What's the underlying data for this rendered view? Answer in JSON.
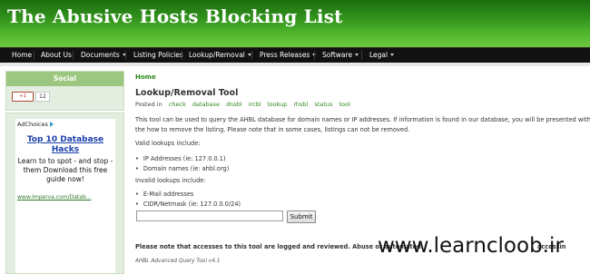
{
  "site": {
    "title": "The Abusive Hosts Blocking List"
  },
  "nav": {
    "items": [
      {
        "label": "Home",
        "dropdown": false
      },
      {
        "label": "About Us",
        "dropdown": false
      },
      {
        "label": "Documents",
        "dropdown": true
      },
      {
        "label": "Listing Policies",
        "dropdown": false
      },
      {
        "label": "Lookup/Removal",
        "dropdown": true
      },
      {
        "label": "Press Releases",
        "dropdown": true
      },
      {
        "label": "Software",
        "dropdown": true
      },
      {
        "label": "Legal",
        "dropdown": true
      }
    ]
  },
  "sidebar": {
    "social": {
      "heading": "Social",
      "plusone_label": "+1",
      "plusone_count": "12"
    },
    "ad": {
      "choices_label": "AdChoices",
      "title": "Top 10 Database Hacks",
      "description": "Learn to to spot - and stop - them Download this free guide now!",
      "url": "www.Imperva.com/Datab..."
    }
  },
  "content": {
    "breadcrumb": "Home",
    "title": "Lookup/Removal Tool",
    "posted_label": "Posted in",
    "tags": [
      "check",
      "database",
      "dnsbl",
      "ircbl",
      "lookup",
      "rhsbl",
      "status",
      "tool"
    ],
    "intro": "This tool can be used to query the AHBL database for domain names or IP addresses. If information is found in our database, you will be presented with the how to remove the listing. Please note that in some cases, listings can not be removed.",
    "valid_label": "Valid lookups include:",
    "valid_items": [
      "IP Addresses (ie: 127.0.0.1)",
      "Domain names (ie: ahbl.org)"
    ],
    "invalid_label": "Invalid lookups include:",
    "invalid_items": [
      "E-Mail addresses",
      "CIDR/Netmask (ie: 127.0.0.0/24)"
    ],
    "query_value": "",
    "submit_label": "Submit",
    "notice": "Please note that accesses to this tool are logged and reviewed. Abuse or automated",
    "notice_tail": "accessin",
    "footer_tool": "AHBL Advanced Query Tool v4.1"
  },
  "watermark": "www.learncloob.ir"
}
